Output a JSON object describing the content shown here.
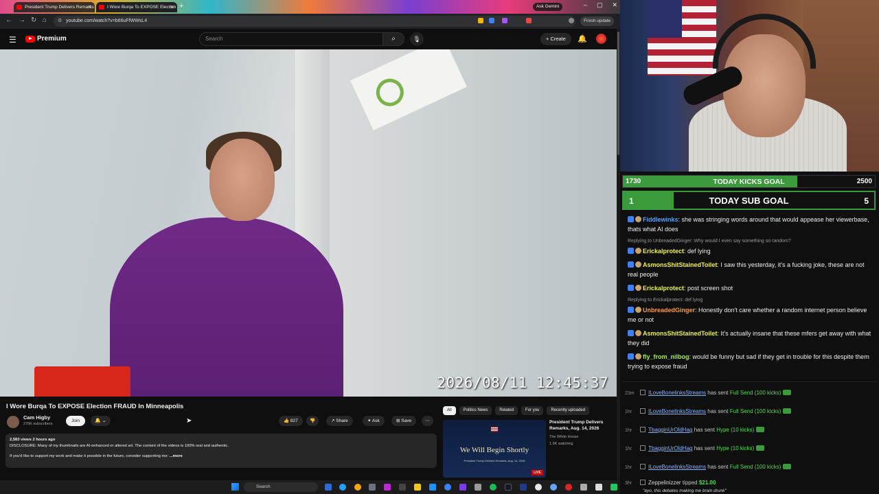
{
  "browser": {
    "tabs": [
      {
        "title": "President Trump Delivers Remarks"
      },
      {
        "title": "I Wore Burqa To EXPOSE Election"
      }
    ],
    "ask_gemini": "Ask Gemini",
    "url": "youtube.com/watch?v=b66uFfWWsL4",
    "finish_update": "Finish update"
  },
  "youtube": {
    "logo": "Premium",
    "search_placeholder": "Search",
    "create_label": "+ Create"
  },
  "video": {
    "timestamp_overlay": "2026/08/11  12:45:37",
    "title": "I Wore Burqa To EXPOSE Election FRAUD In Minneapolis",
    "channel": "Cam Higby",
    "subscribers": "276K subscribers",
    "join_label": "Join",
    "like_count": "827",
    "share_label": "Share",
    "ask_label": "Ask",
    "save_label": "Save",
    "views_line": "2,583 views  2 hours ago",
    "disclosure": "DISCLOSURE: Many of my thumbnails are AI-enhanced or altered art. The content of the videos is 100% real and authentic.",
    "support_line": "If you'd like to support my work and make it possible in the future, consider supporting me:",
    "more_label": "...more"
  },
  "recommendations": {
    "chips": [
      "All",
      "Politics News",
      "Related",
      "For you",
      "Recently uploaded"
    ],
    "item": {
      "title": "President Trump Delivers Remarks, Aug. 14, 2026",
      "channel": "The White House",
      "watching": "1.9K watching",
      "thumb_big": "We Will Begin Shortly",
      "thumb_small": "President Trump Delivers Remarks, Aug. 14, 2026",
      "live_badge": "LIVE"
    }
  },
  "taskbar": {
    "search_placeholder": "Search"
  },
  "goals": {
    "kicks": {
      "current": "1730",
      "label": "TODAY KICKS GOAL",
      "target": "2500",
      "progress": 0.692
    },
    "subs": {
      "current": "1",
      "label": "TODAY SUB GOAL",
      "target": "5",
      "progress": 0.2
    }
  },
  "chat": [
    {
      "user": "Fiddlewinks",
      "color": "#4aa8ff",
      "text": "she was stringing words around that would appease her viewerbase, thats what AI does"
    },
    {
      "reply": "Replying to UnbreadedGinger: Why would I even say something so random?"
    },
    {
      "user": "Erickalprotect",
      "color": "#f0f04a",
      "text": "def lying"
    },
    {
      "user": "AsmonsShitStainedToilet",
      "color": "#f0f04a",
      "text": "I saw this yesterday, it's a fucking joke, these are not real people"
    },
    {
      "user": "Erickalprotect",
      "color": "#f0f04a",
      "text": "post screen shot"
    },
    {
      "reply": "Replying to Erickalprotect: def lying"
    },
    {
      "user": "UnbreadedGinger",
      "color": "#ff9a3c",
      "text": "Honestly don't care whether a random internet person believe me or not"
    },
    {
      "user": "AsmonsShitStainedToilet",
      "color": "#f0f04a",
      "text": "It's actually insane that these mfers get away with what they did"
    },
    {
      "user": "fly_from_nilbog",
      "color": "#9ef04a",
      "text": "would be funny but sad if they get in trouble for this despite them trying to expose fraud"
    }
  ],
  "kicks_feed": [
    {
      "time": "23m",
      "user": "ILoveBonelinksStreams",
      "action": "has sent",
      "gift": "Full Send (100 kicks)"
    },
    {
      "time": "1hr",
      "user": "ILoveBonelinksStreams",
      "action": "has sent",
      "gift": "Full Send (100 kicks)"
    },
    {
      "time": "1hr",
      "user": "TbagginUrOldHag",
      "action": "has sent",
      "gift": "Hype (10 kicks)"
    },
    {
      "time": "1hr",
      "user": "TbagginUrOldHag",
      "action": "has sent",
      "gift": "Hype (10 kicks)"
    },
    {
      "time": "1hr",
      "user": "ILoveBonelinksStreams",
      "action": "has sent",
      "gift": "Full Send (100 kicks)"
    }
  ],
  "tip": {
    "time": "3hr",
    "user": "Zeppelinizzer",
    "action": "tipped",
    "amount": "$21.00",
    "message": "\"ayo, this debates making me brain drunk\""
  },
  "colors": {
    "accent_green": "#3a9a3c",
    "yt_red": "#ff0000"
  }
}
